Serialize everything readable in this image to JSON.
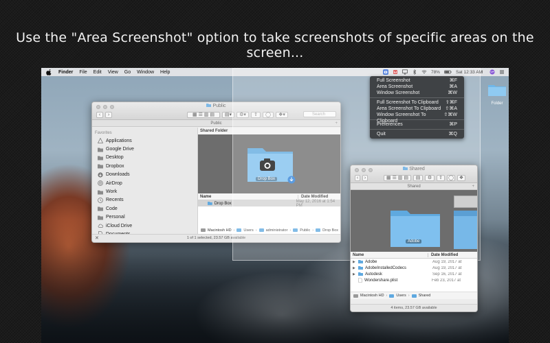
{
  "headline": "Use the \"Area Screenshot\" option to take screenshots of specific areas on the screen...",
  "menubar": {
    "app_name": "Finder",
    "menus": [
      "File",
      "Edit",
      "View",
      "Go",
      "Window",
      "Help"
    ],
    "battery": "78%",
    "clock": "Sat 12:33 AM"
  },
  "dropdown": {
    "group1": [
      {
        "label": "Full Screenshot",
        "shortcut": "⌘F"
      },
      {
        "label": "Area Screenshot",
        "shortcut": "⌘A"
      },
      {
        "label": "Window Screenshot",
        "shortcut": "⌘W"
      }
    ],
    "group2": [
      {
        "label": "Full Screenshot To Clipboard",
        "shortcut": "⇧⌘F"
      },
      {
        "label": "Area Screenshot To Clipboard",
        "shortcut": "⇧⌘A"
      },
      {
        "label": "Window Screenshot To Clipboard",
        "shortcut": "⇧⌘W"
      }
    ],
    "group3": [
      {
        "label": "Preferences",
        "shortcut": "⌘P"
      }
    ],
    "group4": [
      {
        "label": "Quit",
        "shortcut": "⌘Q"
      }
    ]
  },
  "desktop_folder": {
    "label": "Folder"
  },
  "window_public": {
    "title": "Public",
    "search_placeholder": "Search",
    "path_tab": "Public",
    "sidebar_heading": "Favorites",
    "sidebar_items": [
      {
        "label": "Applications",
        "icon": "applications-icon"
      },
      {
        "label": "Google Drive",
        "icon": "folder-icon"
      },
      {
        "label": "Desktop",
        "icon": "folder-icon"
      },
      {
        "label": "Dropbox",
        "icon": "folder-icon"
      },
      {
        "label": "Downloads",
        "icon": "downloads-icon"
      },
      {
        "label": "AirDrop",
        "icon": "airdrop-icon"
      },
      {
        "label": "Work",
        "icon": "folder-icon"
      },
      {
        "label": "Recents",
        "icon": "clock-icon"
      },
      {
        "label": "Code",
        "icon": "folder-icon"
      },
      {
        "label": "Personal",
        "icon": "folder-icon"
      },
      {
        "label": "iCloud Drive",
        "icon": "cloud-icon"
      },
      {
        "label": "Documents",
        "icon": "document-icon"
      }
    ],
    "preview_header": "Shared Folder",
    "preview_item_label": "Drop Box",
    "columns": {
      "name": "Name",
      "date": "Date Modified"
    },
    "rows": [
      {
        "name": "Drop Box",
        "date": "May 12, 2016 at 1:54 PM"
      }
    ],
    "path": [
      "Macintosh HD",
      "Users",
      "administrator",
      "Public",
      "Drop Box"
    ],
    "status": "1 of 1 selected, 23.57 GB available"
  },
  "window_shared": {
    "title": "Shared",
    "path_tab": "Shared",
    "preview_item_label": "Adobe",
    "columns": {
      "name": "Name",
      "date": "Date Modified"
    },
    "rows": [
      {
        "name": "Adobe",
        "date": "Aug 19, 2017 at"
      },
      {
        "name": "AdobeInstalledCodecs",
        "date": "Aug 19, 2017 at"
      },
      {
        "name": "Autodesk",
        "date": "Sep 16, 2017 at"
      },
      {
        "name": "Wondershare.plist",
        "date": "Feb 23, 2017 at"
      }
    ],
    "path": [
      "Macintosh HD",
      "Users",
      "Shared"
    ],
    "status": "4 items, 23.57 GB available"
  }
}
